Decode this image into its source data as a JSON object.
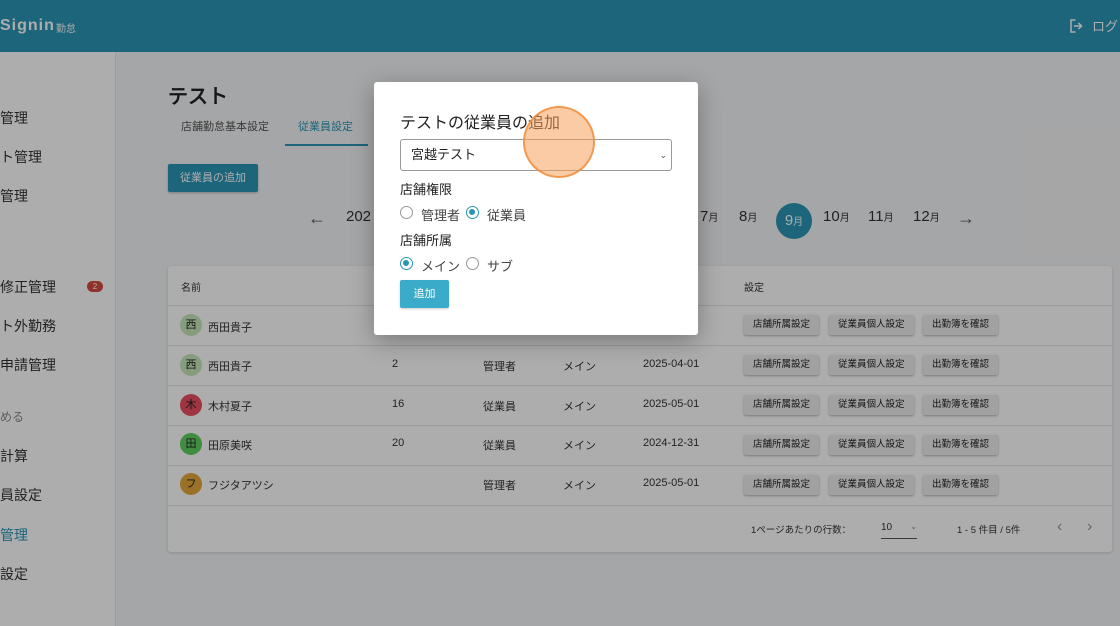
{
  "header": {
    "brand": "Signin",
    "brand_sub": "勤怠",
    "logout_label": "ログ"
  },
  "sidebar": {
    "items": [
      {
        "label": "管理"
      },
      {
        "label": "ト管理"
      },
      {
        "label": "管理"
      },
      {
        "label": "修正管理",
        "badge": "2"
      },
      {
        "label": "ト外勤務"
      },
      {
        "label": "申請管理"
      },
      {
        "label": "める"
      },
      {
        "label": "計算"
      },
      {
        "label": "員設定"
      },
      {
        "label": "管理"
      },
      {
        "label": "設定"
      }
    ]
  },
  "main": {
    "title": "テスト",
    "tabs": [
      {
        "label": "店舗勤怠基本設定"
      },
      {
        "label": "従業員設定"
      }
    ],
    "add_button": "従業員の追加",
    "year_partial": "202",
    "months": [
      "7",
      "8",
      "9",
      "10",
      "11",
      "12"
    ],
    "month_unit": "月",
    "active_month": "9"
  },
  "table": {
    "headers": [
      "名前",
      "設定"
    ],
    "rows": [
      {
        "initial": "西",
        "avatar_color": "#c5e6b8",
        "name": "西田貴子",
        "col2": "",
        "role": "",
        "store": "",
        "date": ""
      },
      {
        "initial": "西",
        "avatar_color": "#c5e6b8",
        "name": "西田貴子",
        "col2": "2",
        "role": "管理者",
        "store": "メイン",
        "date": "2025-04-01"
      },
      {
        "initial": "木",
        "avatar_color": "#e94f5f",
        "name": "木村夏子",
        "col2": "16",
        "role": "従業員",
        "store": "メイン",
        "date": "2025-05-01"
      },
      {
        "initial": "田",
        "avatar_color": "#5fcf5f",
        "name": "田原美咲",
        "col2": "20",
        "role": "従業員",
        "store": "メイン",
        "date": "2024-12-31"
      },
      {
        "initial": "フ",
        "avatar_color": "#e3a93a",
        "name": "フジタアツシ",
        "col2": "",
        "role": "管理者",
        "store": "メイン",
        "date": "2025-05-01"
      }
    ],
    "actions": [
      "店舗所属設定",
      "従業員個人設定",
      "出勤簿を確認"
    ],
    "footer": {
      "rows_per_page_label": "1ページあたりの行数：",
      "rows_per_page": "10",
      "range": "1 - 5 件目 / 5件"
    }
  },
  "dialog": {
    "title": "テストの従業員の追加",
    "selected_employee": "宮越テスト",
    "permission_label": "店舗権限",
    "permission_options": [
      "管理者",
      "従業員"
    ],
    "permission_selected": "従業員",
    "affiliation_label": "店舗所属",
    "affiliation_options": [
      "メイン",
      "サブ"
    ],
    "affiliation_selected": "メイン",
    "submit_label": "追加"
  },
  "colors": {
    "primary": "#2a96b4",
    "badge": "#d24b3e"
  }
}
